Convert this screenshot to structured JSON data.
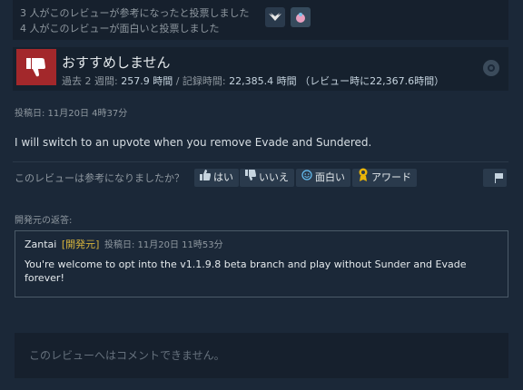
{
  "votes": {
    "helpful_line": "3 人がこのレビューが参考になったと投票しました",
    "funny_line": "4 人がこのレビューが面白いと投票しました"
  },
  "awards": [
    {
      "icon": "wings-award-icon"
    },
    {
      "icon": "heart-award-icon"
    }
  ],
  "review": {
    "verdict": "おすすめしません",
    "hours_label": "過去 2 週間: ",
    "hours_recent": "257.9 時間",
    "separator": " / ",
    "hours_total_label": "記録時間: ",
    "hours_total": "22,385.4 時間",
    "hours_at_review": " （レビュー時に22,367.6時間）",
    "posted": "投稿日: 11月20日 4時37分",
    "text": "I will switch to an upvote when you remove Evade and Sundered."
  },
  "rating_bar": {
    "prompt": "このレビューは参考になりましたか？",
    "yes": "はい",
    "no": "いいえ",
    "funny": "面白い",
    "award": "アワード"
  },
  "developer_response": {
    "label": "開発元の返答:",
    "name": "Zantai",
    "badge": "[開発元]",
    "date": "投稿日: 11月20日 11時53分",
    "message": "You're welcome to opt into the v1.1.9.8 beta branch and play without Sunder and Evade forever!"
  },
  "comments": {
    "disabled_text": "このレビューへはコメントできません。"
  },
  "colors": {
    "background": "#1b2838",
    "thumb_down": "#a3282b",
    "dev_badge": "#d6b33c",
    "award_gold": "#e8b30a"
  }
}
